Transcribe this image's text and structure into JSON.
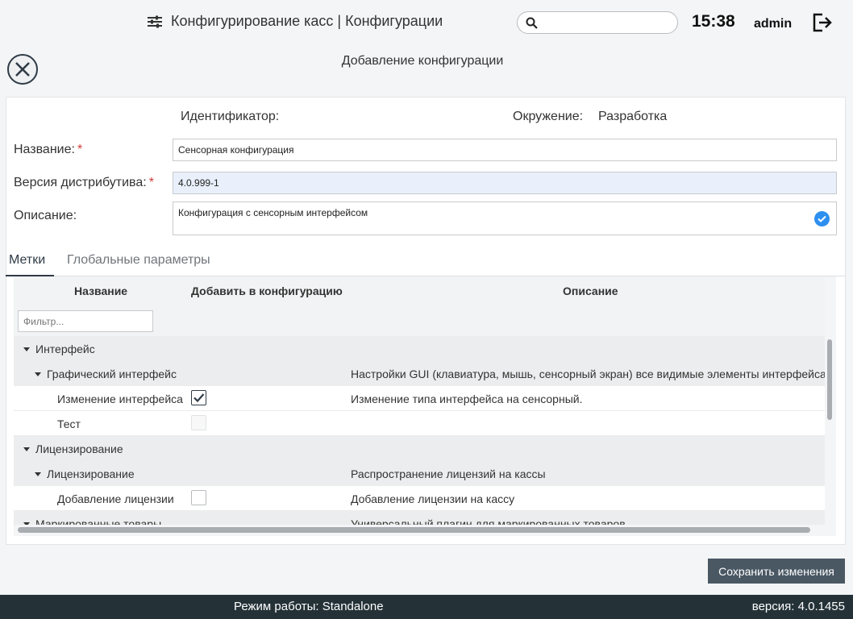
{
  "header": {
    "title": "Конфигурирование касс | Конфигурации",
    "search_placeholder": "",
    "time": "15:38",
    "user": "admin"
  },
  "dialog": {
    "title": "Добавление конфигурации"
  },
  "form": {
    "identifier_label": "Идентификатор:",
    "environment_label": "Окружение:",
    "environment_value": "Разработка",
    "name_label": "Название:",
    "name_value": "Сенсорная конфигурация",
    "distr_label": "Версия дистрибутива:",
    "distr_value": "4.0.999-1",
    "desc_label": "Описание:",
    "desc_value": "Конфигурация с сенсорным интерфейсом",
    "required_mark": "*"
  },
  "tabs": [
    {
      "label": "Метки",
      "active": true
    },
    {
      "label": "Глобальные параметры",
      "active": false
    }
  ],
  "grid": {
    "columns": [
      "Название",
      "Добавить в конфигурацию",
      "Описание"
    ],
    "filter_placeholder": "Фильтр...",
    "rows": [
      {
        "level": 0,
        "type": "group",
        "name": "Интерфейс",
        "desc": ""
      },
      {
        "level": 1,
        "type": "group",
        "name": "Графический интерфейс",
        "desc": "Настройки GUI (клавиатура, мышь, сенсорный экран) все видимые элементы интерфейса"
      },
      {
        "level": 2,
        "type": "item",
        "name": "Изменение интерфейса",
        "checked": true,
        "disabled": false,
        "desc": "Изменение типа интерфейса на сенсорный."
      },
      {
        "level": 2,
        "type": "item",
        "name": "Тест",
        "checked": false,
        "disabled": true,
        "desc": ""
      },
      {
        "level": 0,
        "type": "group",
        "name": "Лицензирование",
        "desc": ""
      },
      {
        "level": 1,
        "type": "group",
        "name": "Лицензирование",
        "desc": "Распространение лицензий на кассы"
      },
      {
        "level": 2,
        "type": "item",
        "name": "Добавление лицензии",
        "checked": false,
        "disabled": false,
        "desc": "Добавление лицензии на кассу"
      },
      {
        "level": 0,
        "type": "group",
        "name": "Маркированные товары",
        "desc": "Универсальный плагин для маркированных товаров"
      }
    ]
  },
  "actions": {
    "save_label": "Сохранить изменения"
  },
  "footer": {
    "mode": "Режим работы: Standalone",
    "version": "версия: 4.0.1455"
  },
  "colors": {
    "footer_bg": "#243238",
    "save_bg": "#4a5864",
    "accent_check": "#2d8ff0",
    "required": "#d23b3b"
  }
}
